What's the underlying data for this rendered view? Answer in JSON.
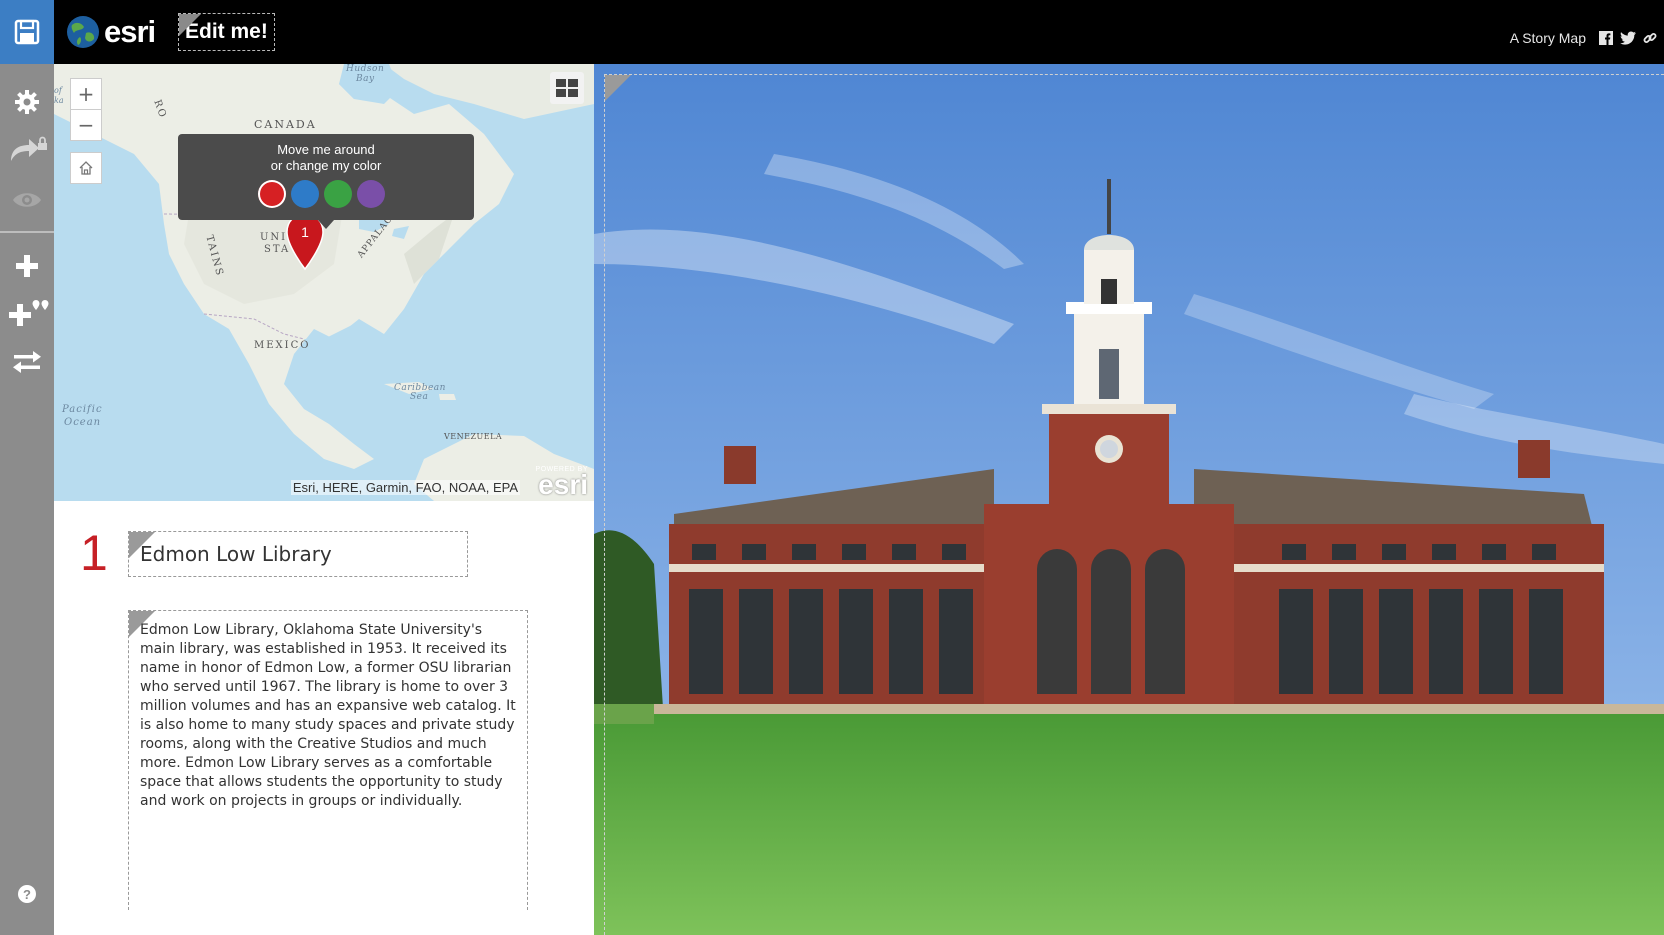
{
  "header": {
    "logo_text": "esri",
    "title": "Edit me!",
    "tagline": "A Story Map"
  },
  "sidebar": {
    "items": [
      {
        "name": "save",
        "icon": "save-icon"
      },
      {
        "name": "settings",
        "icon": "gear-icon"
      },
      {
        "name": "share",
        "icon": "share-locked-icon"
      },
      {
        "name": "preview",
        "icon": "eye-icon"
      },
      {
        "name": "add",
        "icon": "plus-icon"
      },
      {
        "name": "add-places",
        "icon": "plus-pins-icon"
      },
      {
        "name": "organize",
        "icon": "swap-arrows-icon"
      },
      {
        "name": "help",
        "icon": "help-icon"
      }
    ]
  },
  "map": {
    "zoom_in": "+",
    "zoom_out": "−",
    "popup": {
      "line1": "Move me around",
      "line2": "or change my color",
      "colors": [
        "#d62023",
        "#2e7bc8",
        "#3aa244",
        "#7a4fa8"
      ]
    },
    "marker_number": "1",
    "labels": {
      "hudson": "Hudson",
      "bay": "Bay",
      "canada": "CANADA",
      "united": "UNI",
      "states": "STA",
      "appalachian": "APPALACHIAN MTNS",
      "mexico": "MEXICO",
      "pacific": "Pacific",
      "ocean": "Ocean",
      "caribbean": "Caribbean",
      "sea": "Sea",
      "venezuela": "VENEZUELA",
      "powered_by": "POWERED BY",
      "esri": "esri",
      "of": "of",
      "ka": "ka",
      "ro": "RO",
      "tains": "TAINS"
    },
    "attribution": "Esri, HERE, Garmin, FAO, NOAA, EPA"
  },
  "entry": {
    "number": "1",
    "title": "Edmon Low Library",
    "description": "Edmon Low Library, Oklahoma State University's main library, was established in 1953. It received its name in honor of Edmon Low, a former OSU librarian who served until 1967. The library is home to over 3 million volumes and has an expansive web catalog. It is also home to many study spaces and private study rooms, along with the Creative Studios and much more. Edmon Low Library serves as a comfortable space that allows students the opportunity to study and work on projects in groups or individually."
  },
  "colors": {
    "sidebar": "#8c8c8c",
    "save_accent": "#3c7ec4",
    "number_red": "#c62026",
    "topbar": "#000000"
  }
}
